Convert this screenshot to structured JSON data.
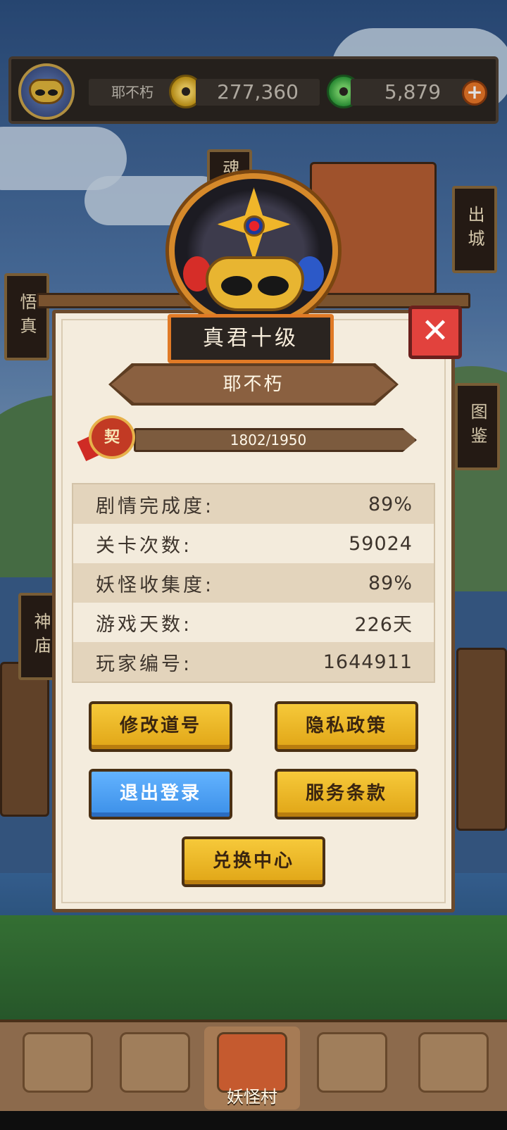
{
  "hud": {
    "player_name": "耶不朽",
    "gold": "277,360",
    "jade": "5,879",
    "plus": "+"
  },
  "side_signs": {
    "left_top": "悟真塔",
    "left_bottom": "神庙",
    "right_top": "出城",
    "right_middle": "图鉴",
    "center_top": "魂"
  },
  "profile": {
    "rank": "真君十级",
    "name": "耶不朽",
    "seal_char": "契",
    "exp_text": "1802/1950",
    "exp_progress": 0.924,
    "close": "✕"
  },
  "stats": [
    {
      "label": "剧情完成度:",
      "value": "89%"
    },
    {
      "label": "关卡次数:",
      "value": "59024"
    },
    {
      "label": "妖怪收集度:",
      "value": "89%"
    },
    {
      "label": "游戏天数:",
      "value": "226天"
    },
    {
      "label": "玩家编号:",
      "value": "1644911"
    }
  ],
  "buttons": {
    "rename": "修改道号",
    "privacy": "隐私政策",
    "logout": "退出登录",
    "terms": "服务条款",
    "redeem": "兑换中心"
  },
  "nav": {
    "active_label": "妖怪村"
  },
  "colors": {
    "panel": "#f4ecdd",
    "gold_button": "#f0b62a",
    "blue_button": "#3b8fe8",
    "close_button": "#e2423d"
  }
}
